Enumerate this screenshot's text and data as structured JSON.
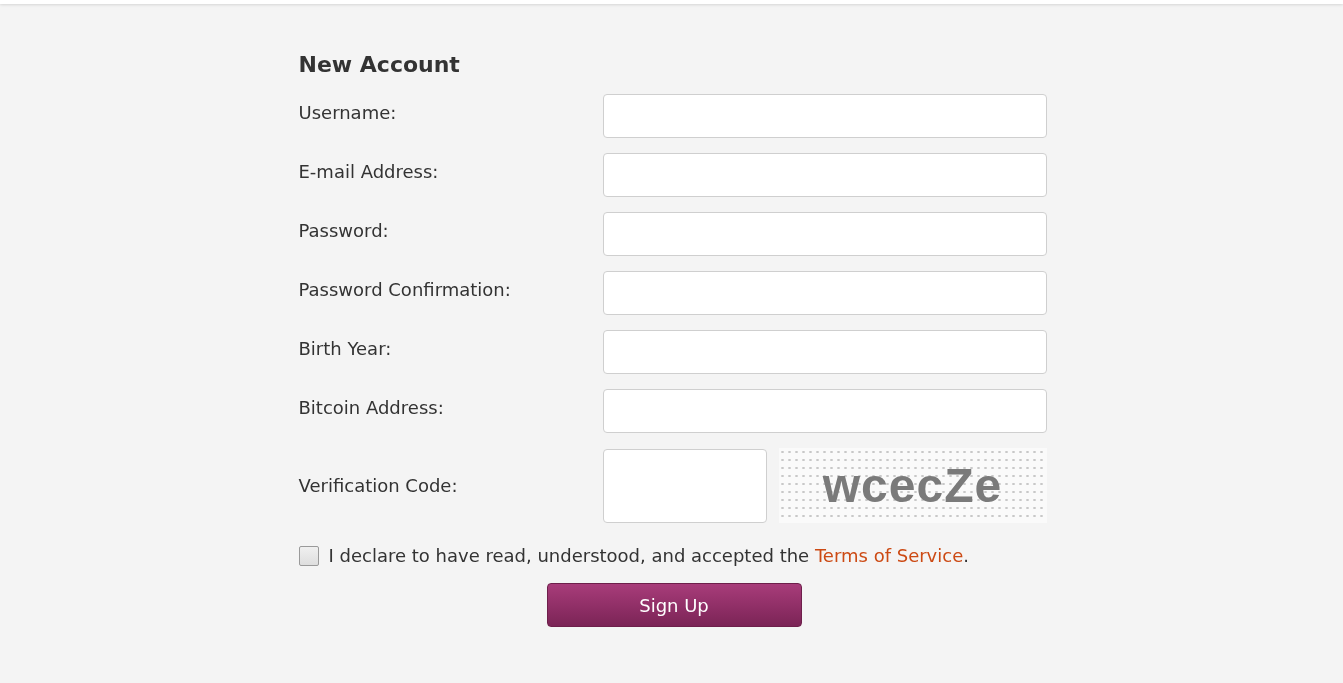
{
  "form": {
    "title": "New Account",
    "fields": [
      {
        "label": "Username:"
      },
      {
        "label": "E-mail Address:"
      },
      {
        "label": "Password:"
      },
      {
        "label": "Password Confirmation:"
      },
      {
        "label": "Birth Year:"
      },
      {
        "label": "Bitcoin Address:"
      }
    ],
    "verification": {
      "label": "Verification Code:",
      "captcha_text": "wcecZe"
    },
    "agreement": {
      "checked": false,
      "text_before": "I declare to have read, understood, and accepted the ",
      "link": "Terms of Service",
      "text_after": "."
    },
    "submit": {
      "label": "Sign Up"
    }
  }
}
